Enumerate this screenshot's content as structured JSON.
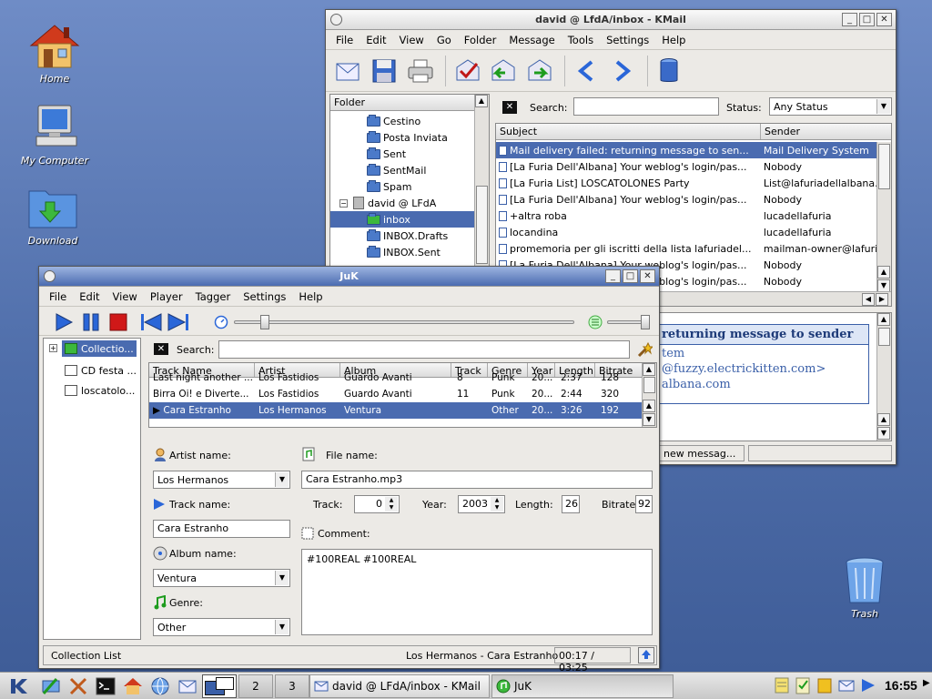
{
  "desktop": {
    "icons": [
      "Home",
      "My Computer",
      "Download",
      "Trash"
    ]
  },
  "kmail": {
    "title": "david @ LfdA/inbox - KMail",
    "menu": [
      "File",
      "Edit",
      "View",
      "Go",
      "Folder",
      "Message",
      "Tools",
      "Settings",
      "Help"
    ],
    "folder_header": "Folder",
    "folders": [
      {
        "label": "Cestino",
        "indent": 2
      },
      {
        "label": "Posta Inviata",
        "indent": 2
      },
      {
        "label": "Sent",
        "indent": 2
      },
      {
        "label": "SentMail",
        "indent": 2
      },
      {
        "label": "Spam",
        "indent": 2
      },
      {
        "label": "david @ LFdA",
        "indent": 1
      },
      {
        "label": "inbox",
        "indent": 2,
        "selected": true
      },
      {
        "label": "INBOX.Drafts",
        "indent": 2
      },
      {
        "label": "INBOX.Sent",
        "indent": 2
      }
    ],
    "search_label": "Search:",
    "status_label": "Status:",
    "status_value": "Any Status",
    "columns": [
      "Subject",
      "Sender"
    ],
    "messages": [
      {
        "subject": "Mail delivery failed: returning message to sen...",
        "sender": "Mail Delivery System",
        "selected": true
      },
      {
        "subject": "[La Furia Dell'Albana] Your weblog's login/pas...",
        "sender": "Nobody"
      },
      {
        "subject": "[La Furia List] LOSCATOLONES Party",
        "sender": "List@lafuriadellalbana..."
      },
      {
        "subject": "[La Furia Dell'Albana] Your weblog's login/pas...",
        "sender": "Nobody"
      },
      {
        "subject": "+altra roba",
        "sender": "lucadellafuria"
      },
      {
        "subject": "locandina",
        "sender": "lucadellafuria"
      },
      {
        "subject": "promemoria per gli iscritti della lista lafuriadel...",
        "sender": "mailman-owner@lafuri"
      },
      {
        "subject": "[La Furia Dell'Albana] Your weblog's login/pas...",
        "sender": "Nobody"
      },
      {
        "subject": "[La Furia Dell'Albana] Your weblog's login/pas...",
        "sender": "Nobody"
      }
    ],
    "preview_title": "returning message to sender",
    "preview_lines": [
      "tem",
      "@fuzzy.electrickitten.com>",
      "albana.com"
    ],
    "statusbar": "new messag..."
  },
  "juk": {
    "title": "JuK",
    "menu": [
      "File",
      "Edit",
      "View",
      "Player",
      "Tagger",
      "Settings",
      "Help"
    ],
    "playlists": [
      "Collectio...",
      "CD festa ...",
      "loscatolo..."
    ],
    "search_label": "Search:",
    "columns": [
      "Track Name",
      "Artist",
      "Album",
      "Track",
      "Genre",
      "Year",
      "Length",
      "Bitrate"
    ],
    "tracks": [
      {
        "name": "Last night another ...",
        "artist": "Los Fastidios",
        "album": "Guardo Avanti",
        "track": "8",
        "genre": "Punk",
        "year": "20...",
        "length": "2:37",
        "bitrate": "128"
      },
      {
        "name": "Birra Oi! e Diverte...",
        "artist": "Los Fastidios",
        "album": "Guardo Avanti",
        "track": "11",
        "genre": "Punk",
        "year": "20...",
        "length": "2:44",
        "bitrate": "320"
      },
      {
        "name": "Cara Estranho",
        "artist": "Los Hermanos",
        "album": "Ventura",
        "track": "",
        "genre": "Other",
        "year": "20...",
        "length": "3:26",
        "bitrate": "192",
        "selected": true
      }
    ],
    "tagger": {
      "artist_label": "Artist name:",
      "artist_value": "Los Hermanos",
      "track_label": "Track name:",
      "track_value": "Cara Estranho",
      "album_label": "Album name:",
      "album_value": "Ventura",
      "genre_label": "Genre:",
      "genre_value": "Other",
      "file_label": "File name:",
      "file_value": "Cara Estranho.mp3",
      "tracknum_label": "Track:",
      "tracknum_value": "0",
      "year_label": "Year:",
      "year_value": "2003",
      "length_label": "Length:",
      "length_value": "26",
      "bitrate_label": "Bitrate:",
      "bitrate_value": "92",
      "comment_label": "Comment:",
      "comment_value": "#100REAL #100REAL"
    },
    "status_left": "Collection List",
    "status_track": "Los Hermanos - Cara Estranho",
    "status_time": "00:17 / 03:25"
  },
  "taskbar": {
    "desktops": [
      "2",
      "3"
    ],
    "tasks": [
      "david @ LFdA/inbox - KMail",
      "JuK"
    ],
    "clock": "16:55"
  }
}
